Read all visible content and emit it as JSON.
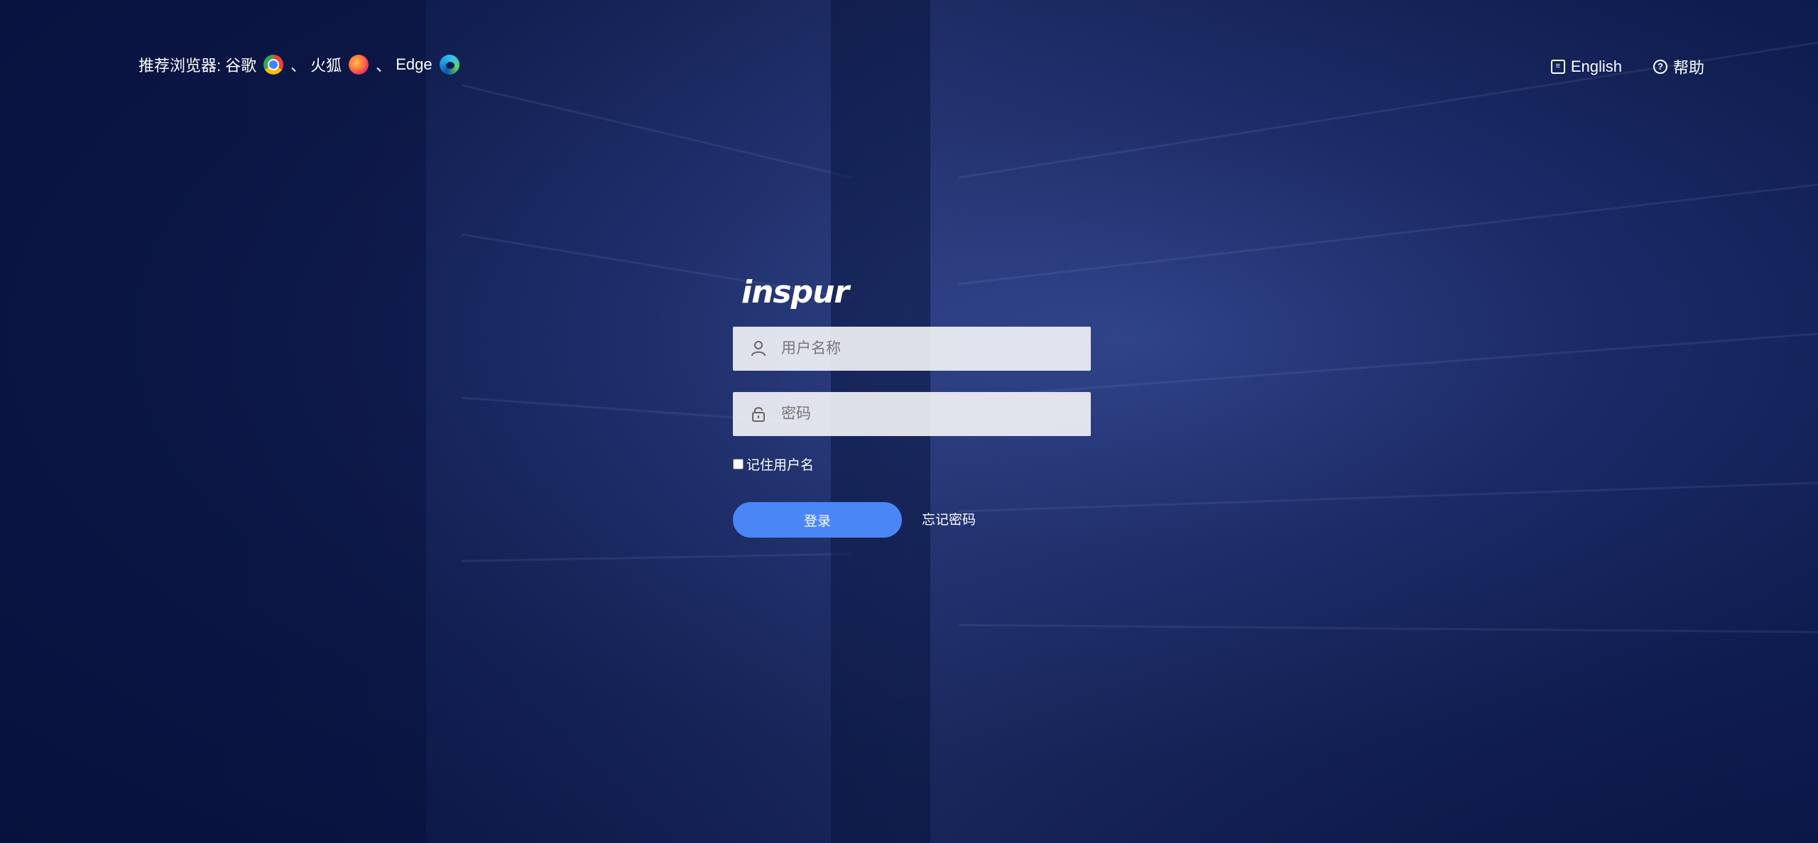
{
  "header": {
    "browsers_label": "推荐浏览器:",
    "browsers": [
      {
        "name": "谷歌",
        "icon": "chrome-icon"
      },
      {
        "name": "火狐",
        "icon": "firefox-icon"
      },
      {
        "name": "Edge",
        "icon": "edge-icon"
      }
    ],
    "separator": "、",
    "language_label": "English",
    "help_label": "帮助"
  },
  "login": {
    "logo_text": "inspur",
    "username_placeholder": "用户名称",
    "password_placeholder": "密码",
    "remember_label": "记住用户名",
    "submit_label": "登录",
    "forgot_label": "忘记密码"
  },
  "colors": {
    "primary_button": "#4a86f5",
    "background": "#0f1c4f"
  }
}
